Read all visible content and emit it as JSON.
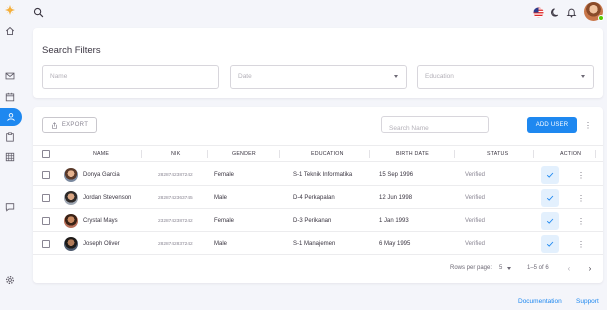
{
  "colors": {
    "accent": "#1e88f0",
    "background": "#f4f5fa",
    "card": "#ffffff",
    "text": "#3a3541"
  },
  "sidebar": {
    "items": [
      {
        "name": "logo",
        "icon": "logo-star-icon"
      },
      {
        "name": "home",
        "icon": "home-icon"
      },
      {
        "name": "mail",
        "icon": "mail-icon"
      },
      {
        "name": "calendar",
        "icon": "calendar-icon"
      },
      {
        "name": "users",
        "icon": "user-icon",
        "active": true
      },
      {
        "name": "clipboard",
        "icon": "clipboard-icon"
      },
      {
        "name": "grid",
        "icon": "grid-icon"
      },
      {
        "name": "chat",
        "icon": "chat-icon"
      },
      {
        "name": "settings",
        "icon": "gear-icon"
      }
    ]
  },
  "topbar": {
    "search_icon": "search-icon",
    "right_icons": [
      "us-flag-icon",
      "moon-icon",
      "bell-icon",
      "avatar"
    ]
  },
  "filters": {
    "title": "Search Filters",
    "name_placeholder": "Name",
    "date_placeholder": "Date",
    "education_placeholder": "Education"
  },
  "toolbar": {
    "export_label": "EXPORT",
    "search_placeholder": "Search Name",
    "add_label": "ADD USER"
  },
  "table": {
    "headers": [
      "NAME",
      "NIK",
      "GENDER",
      "EDUCATION",
      "BIRTH DATE",
      "STATUS",
      "ACTION"
    ],
    "rows": [
      {
        "name": "Donya Garcia",
        "nik": "2828742387242",
        "gender": "Female",
        "education": "S-1 Teknik Informatika",
        "birth_date": "15 Sep 1996",
        "status": "Verified"
      },
      {
        "name": "Jordan Stevenson",
        "nik": "2828742363745",
        "gender": "Male",
        "education": "D-4 Perkapalan",
        "birth_date": "12 Jun 1998",
        "status": "Verified"
      },
      {
        "name": "Crystal Mays",
        "nik": "2328742387242",
        "gender": "Female",
        "education": "D-3 Perikanan",
        "birth_date": "1 Jan 1993",
        "status": "Verified"
      },
      {
        "name": "Joseph Oliver",
        "nik": "2828742837242",
        "gender": "Male",
        "education": "S-1 Manajemen",
        "birth_date": "6 May 1995",
        "status": "Verified"
      }
    ]
  },
  "pagination": {
    "rows_per_page_label": "Rows per page:",
    "rows_per_page_value": "5",
    "range": "1–5 of 6"
  },
  "footer_links": {
    "documentation": "Documentation",
    "support": "Support"
  }
}
